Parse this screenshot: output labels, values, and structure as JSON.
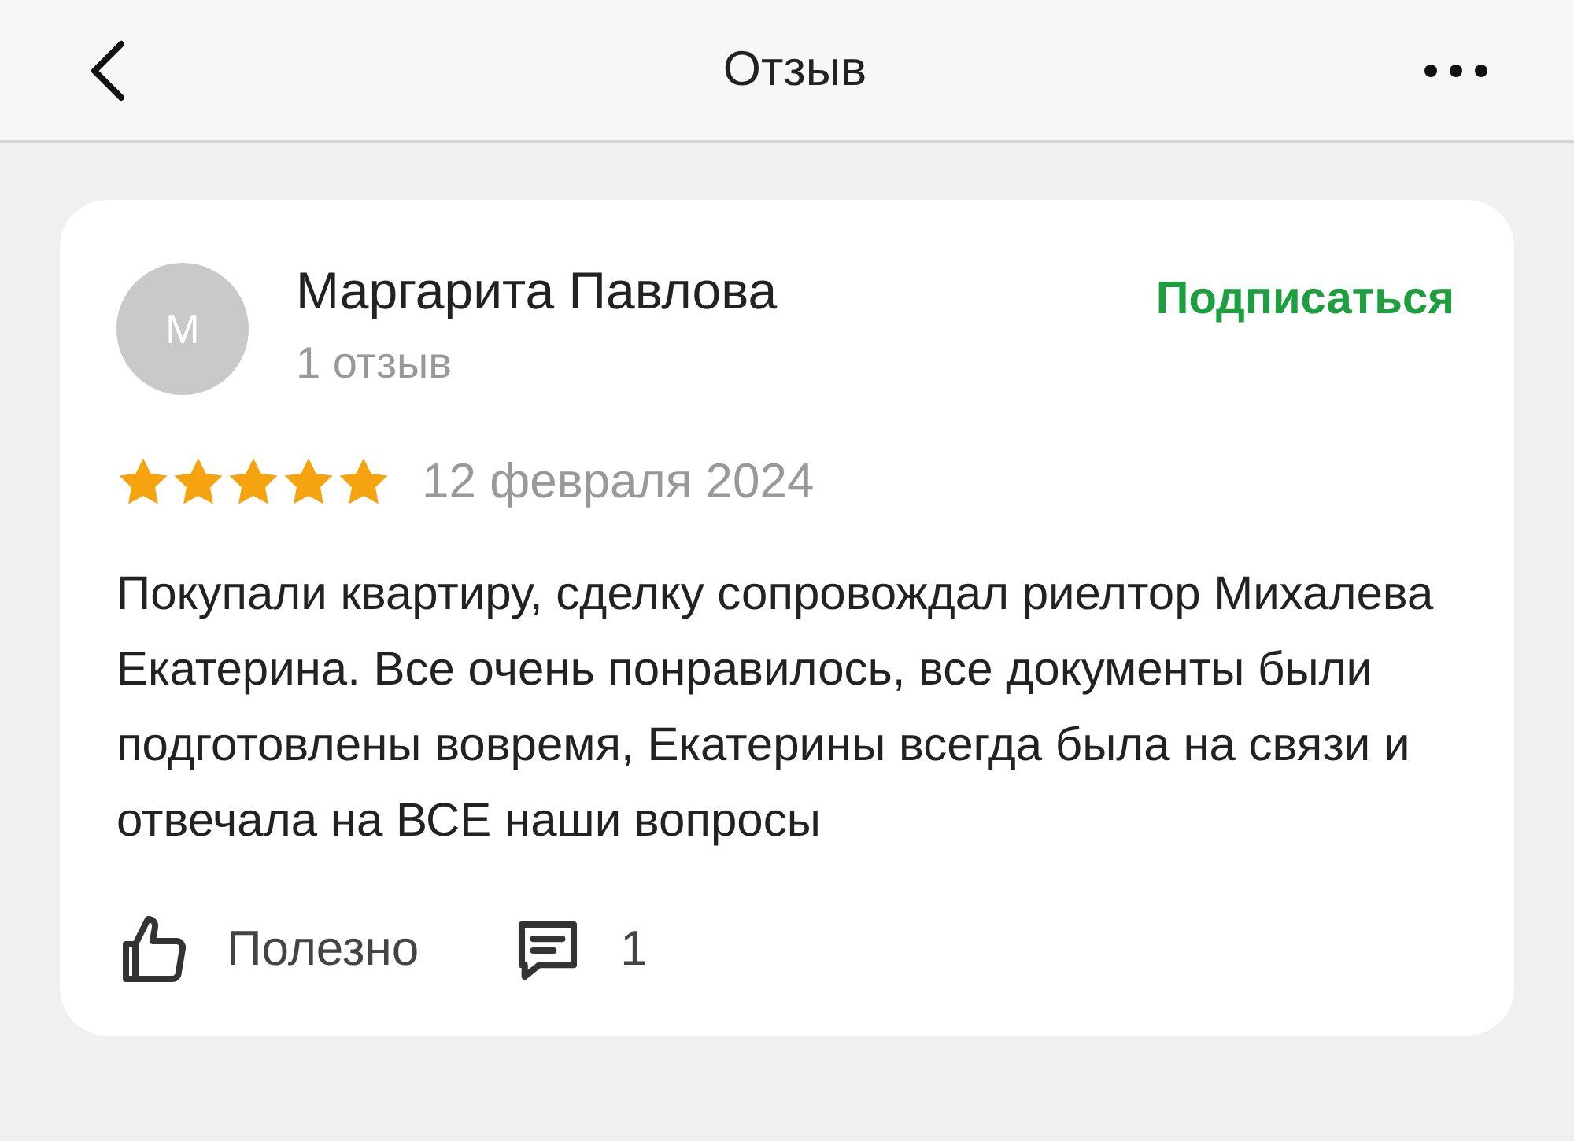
{
  "header": {
    "title": "Отзыв"
  },
  "review": {
    "author": {
      "initial": "М",
      "name": "Маргарита Павлова",
      "reviews_count": "1 отзыв"
    },
    "subscribe": "Подписаться",
    "stars": 5,
    "date": "12 февраля 2024",
    "text": "Покупали квартиру, сделку сопровождал риелтор Михалева Екатерина. Все очень понравилось, все документы были подготовлены вовремя, Екатерины всегда была на связи и отвечала на ВСЕ наши вопросы",
    "helpful": "Полезно",
    "comments": "1"
  }
}
